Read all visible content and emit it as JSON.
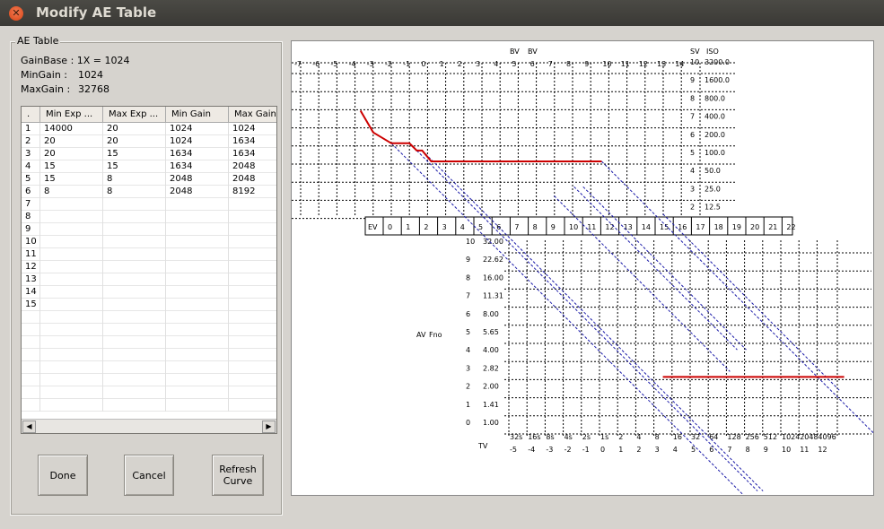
{
  "window": {
    "title": "Modify AE Table"
  },
  "group": {
    "label": "AE Table",
    "gain_base": "GainBase : 1X = 1024",
    "min_gain_label": "MinGain :",
    "min_gain_value": "1024",
    "max_gain_label": "MaxGain :",
    "max_gain_value": "32768"
  },
  "table": {
    "headers": [
      ".",
      "Min Exp ...",
      "Max Exp ...",
      "Min Gain",
      "Max Gain"
    ],
    "rows": [
      [
        "1",
        "14000",
        "20",
        "1024",
        "1024"
      ],
      [
        "2",
        "20",
        "20",
        "1024",
        "1634"
      ],
      [
        "3",
        "20",
        "15",
        "1634",
        "1634"
      ],
      [
        "4",
        "15",
        "15",
        "1634",
        "2048"
      ],
      [
        "5",
        "15",
        "8",
        "2048",
        "2048"
      ],
      [
        "6",
        "8",
        "8",
        "2048",
        "8192"
      ],
      [
        "7",
        "",
        "",
        "",
        ""
      ],
      [
        "8",
        "",
        "",
        "",
        ""
      ],
      [
        "9",
        "",
        "",
        "",
        ""
      ],
      [
        "10",
        "",
        "",
        "",
        ""
      ],
      [
        "11",
        "",
        "",
        "",
        ""
      ],
      [
        "12",
        "",
        "",
        "",
        ""
      ],
      [
        "13",
        "",
        "",
        "",
        ""
      ],
      [
        "14",
        "",
        "",
        "",
        ""
      ],
      [
        "15",
        "",
        "",
        "",
        ""
      ],
      [
        "",
        "",
        "",
        "",
        ""
      ],
      [
        "",
        "",
        "",
        "",
        ""
      ],
      [
        "",
        "",
        "",
        "",
        ""
      ],
      [
        "",
        "",
        "",
        "",
        ""
      ],
      [
        "",
        "",
        "",
        "",
        ""
      ],
      [
        "",
        "",
        "",
        "",
        ""
      ],
      [
        "",
        "",
        "",
        "",
        ""
      ],
      [
        "",
        "",
        "",
        "",
        ""
      ]
    ]
  },
  "buttons": {
    "done": "Done",
    "cancel": "Cancel",
    "refresh_line1": "Refresh",
    "refresh_line2": "Curve"
  },
  "chart_data": {
    "type": "line",
    "bv_label": "BV",
    "sv_label": "SV",
    "iso_label": "ISO",
    "ev_label": "EV",
    "av_label": "AV",
    "fno_label": "Fno",
    "tv_label": "TV",
    "bv_ticks": [
      "-7",
      "-6",
      "-5",
      "-4",
      "-3",
      "-2",
      "-1",
      "0",
      "1",
      "2",
      "3",
      "4",
      "5",
      "6",
      "7",
      "8",
      "9",
      "10",
      "11",
      "12",
      "13",
      "14"
    ],
    "sv_rows": [
      {
        "sv": "10",
        "iso": "3200.0"
      },
      {
        "sv": "9",
        "iso": "1600.0"
      },
      {
        "sv": "8",
        "iso": "800.0"
      },
      {
        "sv": "7",
        "iso": "400.0"
      },
      {
        "sv": "6",
        "iso": "200.0"
      },
      {
        "sv": "5",
        "iso": "100.0"
      },
      {
        "sv": "4",
        "iso": "50.0"
      },
      {
        "sv": "3",
        "iso": "25.0"
      },
      {
        "sv": "2",
        "iso": "12.5"
      }
    ],
    "ev_ticks": [
      "0",
      "1",
      "2",
      "3",
      "4",
      "5",
      "6",
      "7",
      "8",
      "9",
      "10",
      "11",
      "12",
      "13",
      "14",
      "15",
      "16",
      "17",
      "18",
      "19",
      "20",
      "21",
      "22"
    ],
    "av_rows": [
      {
        "av": "10",
        "fno": "32.00"
      },
      {
        "av": "9",
        "fno": "22.62"
      },
      {
        "av": "8",
        "fno": "16.00"
      },
      {
        "av": "7",
        "fno": "11.31"
      },
      {
        "av": "6",
        "fno": "8.00"
      },
      {
        "av": "5",
        "fno": "5.65"
      },
      {
        "av": "4",
        "fno": "4.00"
      },
      {
        "av": "3",
        "fno": "2.82"
      },
      {
        "av": "2",
        "fno": "2.00"
      },
      {
        "av": "1",
        "fno": "1.41"
      },
      {
        "av": "0",
        "fno": "1.00"
      }
    ],
    "tv_time": [
      "32s",
      "16s",
      "8s",
      "4s",
      "2s",
      "1s",
      "2",
      "4",
      "8",
      "16",
      "32",
      "64",
      "128",
      "256",
      "512",
      "1024",
      "2048",
      "4096"
    ],
    "tv_values": [
      "-5",
      "-4",
      "-3",
      "-2",
      "-1",
      "0",
      "1",
      "2",
      "3",
      "4",
      "5",
      "6",
      "7",
      "8",
      "9",
      "10",
      "11",
      "12"
    ],
    "colors": {
      "ae_curve": "#cc0000",
      "guide": "#1a1aa8",
      "grid": "#000000"
    },
    "upper_red_curve": [
      [
        -2,
        7.8
      ],
      [
        -1.3,
        6.6
      ],
      [
        -0.3,
        6
      ],
      [
        0.7,
        6
      ],
      [
        1.1,
        5.6
      ],
      [
        1.4,
        5.6
      ],
      [
        1.9,
        5
      ],
      [
        11.3,
        5
      ]
    ],
    "lower_red_curve": [
      [
        8,
        3
      ],
      [
        18,
        3
      ]
    ],
    "upper_guides": [
      [
        [
          -0.3,
          6
        ],
        [
          19.4,
          -13.7
        ]
      ],
      [
        [
          1.1,
          5.6
        ],
        [
          19.9,
          -13.2
        ]
      ],
      [
        [
          1.4,
          5.6
        ],
        [
          20.2,
          -13.2
        ]
      ],
      [
        [
          11.3,
          5
        ],
        [
          29.4,
          -13.1
        ]
      ]
    ],
    "lower_guides": [
      [
        [
          2,
          13
        ],
        [
          11.7,
          3.3
        ]
      ],
      [
        [
          3.1,
          13.5
        ],
        [
          12.1,
          4.5
        ]
      ],
      [
        [
          3.6,
          13.5
        ],
        [
          12.6,
          4.5
        ]
      ],
      [
        [
          8,
          12
        ],
        [
          17.8,
          2.2
        ]
      ]
    ]
  }
}
